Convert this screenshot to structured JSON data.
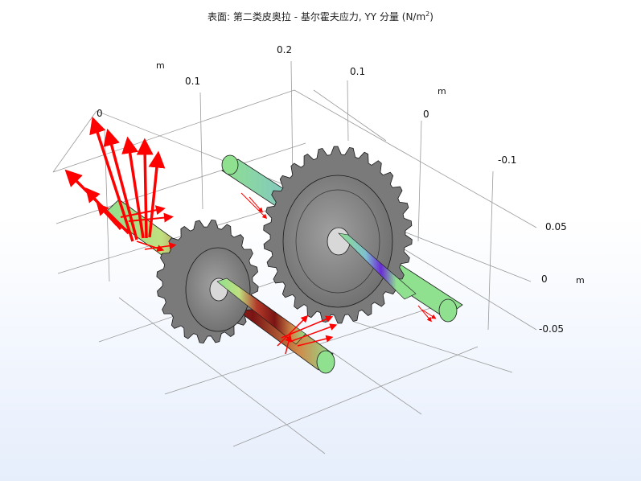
{
  "plot": {
    "title_prefix": "表面: 第二类皮奥拉 - 基尔霍夫应力,   YY 分量 (N/m",
    "title_exp": "2",
    "title_suffix": ")"
  },
  "axes": {
    "x_unit": "m",
    "x_ticks": [
      "0",
      "0.1",
      "0.2"
    ],
    "y_unit": "m",
    "y_ticks": [
      "0.1",
      "0",
      "-0.1"
    ],
    "z_unit": "m",
    "z_ticks": [
      "0.05",
      "0",
      "-0.05"
    ]
  },
  "colors": {
    "shaft_low": "#8fe08f",
    "shaft_high": "#8b1a1a",
    "shaft_violet": "#6a2bd6",
    "gear": "#8c8c8c",
    "arrows": "#ff0000"
  }
}
